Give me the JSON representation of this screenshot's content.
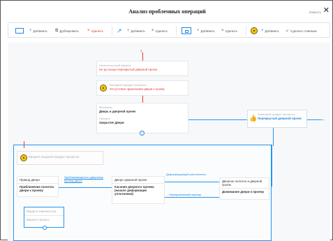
{
  "title": "Анализ проблемных операций",
  "close_label": "Закрыть",
  "toolbar": {
    "add": "Добавить",
    "duplicate": "Дублировать",
    "delete": "Удалить",
    "add2": "Добавить",
    "delete2": "Удалить",
    "add3": "Добавить",
    "delete3": "Удалить",
    "add4": "Добавить",
    "make_main": "Сделать главным"
  },
  "top_chain": {
    "effect_label": "Нежелательный эффект",
    "effect_value": "Не до конца перекрытый дверной проем",
    "output_label": "Выходной продукт процесса",
    "output_value": "Отсутствие прилегания двери к кузову",
    "process_card": {
      "mech_label": "Механизм",
      "mech_value": "Дверь и дверной проем",
      "proc_label": "Процесс",
      "proc_value": "Закрытие двери"
    }
  },
  "right_node": {
    "label": "Заменный продукт процесса",
    "value": "Перекрытый дверной проем"
  },
  "lower": {
    "input_placeholder": "Введите входной продукт процесса",
    "c1_title": "Привод двери",
    "c1_body": "Приближение полотна двери к проему",
    "link1": "Приближающееся к дверному проему дверь",
    "c2_title": "Дверь+дверной проем",
    "c2_body": "Касание дверного проема (начало деформации уплотнения)",
    "link2": "Деформирующий уплотнитель",
    "link3": "Перекрываемый шарнир",
    "c3_title": "Дверное полотно и дверной проем",
    "c3_body": "Дожимание двери к проему",
    "edit_ph1": "Введите компонентов",
    "edit_ph2": "Введите процесс"
  }
}
